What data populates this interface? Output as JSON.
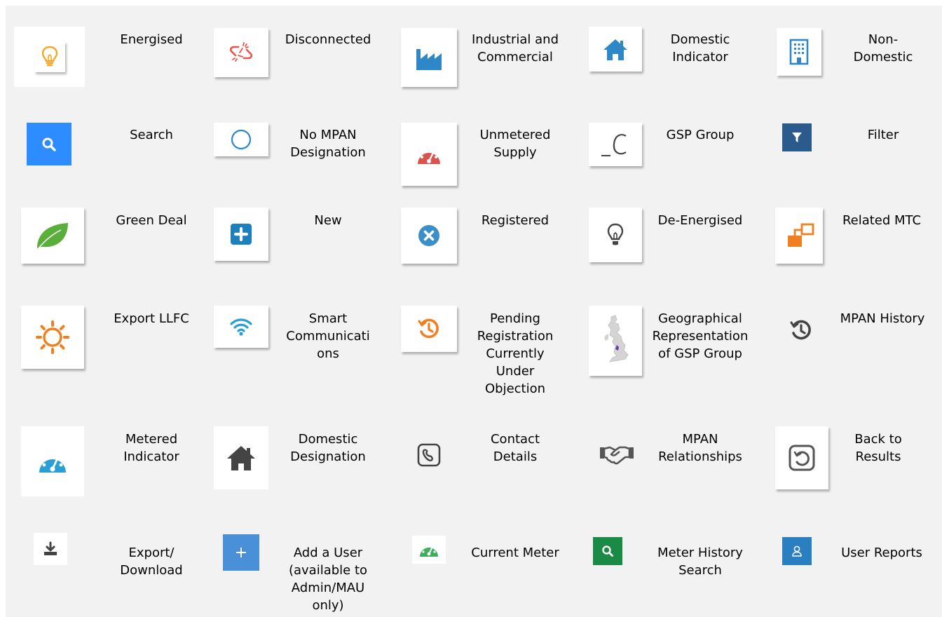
{
  "legend": {
    "row1": [
      {
        "label": "Energised",
        "icon": "energised-bulb-icon"
      },
      {
        "label": "Disconnected",
        "icon": "disconnected-link-icon"
      },
      {
        "label": "Industrial and\nCommercial",
        "icon": "factory-icon"
      },
      {
        "label": "Domestic\nIndicator",
        "icon": "house-icon"
      },
      {
        "label": "Non-\nDomestic",
        "icon": "office-building-icon"
      }
    ],
    "row2": [
      {
        "label": "Search",
        "icon": "search-icon"
      },
      {
        "label": "No MPAN\nDesignation",
        "icon": "circle-outline-icon"
      },
      {
        "label": "Unmetered\nSupply",
        "icon": "gauge-red-icon"
      },
      {
        "label": "GSP Group",
        "icon": "gsp-group-icon"
      },
      {
        "label": "Filter",
        "icon": "filter-icon"
      }
    ],
    "row3": [
      {
        "label": "Green Deal",
        "icon": "leaf-icon"
      },
      {
        "label": "New",
        "icon": "plus-square-icon"
      },
      {
        "label": "Registered",
        "icon": "x-circle-icon"
      },
      {
        "label": "De-Energised",
        "icon": "deenergised-bulb-icon"
      },
      {
        "label": "Related MTC",
        "icon": "related-mtc-icon"
      }
    ],
    "row4": [
      {
        "label": "Export LLFC",
        "icon": "sun-icon"
      },
      {
        "label": "Smart\nCommunicati\nons",
        "icon": "wifi-icon"
      },
      {
        "label": "Pending\nRegistration\nCurrently\nUnder\nObjection",
        "icon": "pending-history-icon"
      },
      {
        "label": "Geographical\nRepresentation\nof GSP Group",
        "icon": "uk-map-icon"
      },
      {
        "label": "MPAN History",
        "icon": "history-icon"
      }
    ],
    "row5": [
      {
        "label": "Metered\nIndicator",
        "icon": "gauge-blue-icon"
      },
      {
        "label": "Domestic\nDesignation",
        "icon": "house-dark-icon"
      },
      {
        "label": "Contact\nDetails",
        "icon": "phone-square-icon"
      },
      {
        "label": "MPAN\nRelationships",
        "icon": "handshake-icon"
      },
      {
        "label": "Back to\nResults",
        "icon": "back-to-results-icon"
      }
    ],
    "row6": [
      {
        "label": "Export/\nDownload",
        "icon": "download-icon"
      },
      {
        "label": "Add a User\n(available to\nAdmin/MAU\nonly)",
        "icon": "add-user-plus-icon"
      },
      {
        "label": "Current Meter",
        "icon": "gauge-green-icon"
      },
      {
        "label": "Meter History\nSearch",
        "icon": "meter-history-search-icon"
      },
      {
        "label": "User Reports",
        "icon": "user-icon"
      }
    ]
  },
  "colors": {
    "background": "#f2f2f2",
    "energised": "#f5a623",
    "disconnected": "#e8534b",
    "factory": "#2e88c8",
    "house": "#2e88c8",
    "search": "#2d8cff",
    "gauge_red": "#d9534f",
    "filter": "#2b5a8c",
    "leaf": "#5aae3a",
    "new": "#1c7fbe",
    "registered": "#3a8ec9",
    "related_mtc": "#f07f1f",
    "sun": "#f07f1f",
    "wifi": "#2a9fd6",
    "pending": "#f07f1f",
    "map_highlight": "#6a3d9a",
    "history": "#444444",
    "gauge_blue": "#2a9fd6",
    "house_dark": "#444444",
    "download": "#444444",
    "add_user": "#4a90d9",
    "gauge_green": "#3cae5c",
    "meter_history": "#1a8a45",
    "user_reports": "#2a7fc1"
  }
}
